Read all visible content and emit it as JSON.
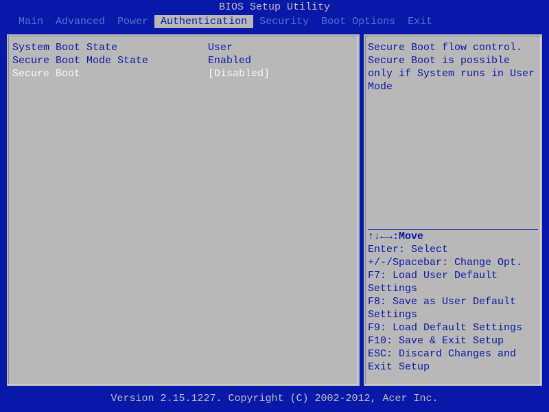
{
  "title": "BIOS Setup Utility",
  "menu": {
    "items": [
      {
        "label": "Main",
        "active": false
      },
      {
        "label": "Advanced",
        "active": false
      },
      {
        "label": "Power",
        "active": false
      },
      {
        "label": "Authentication",
        "active": true
      },
      {
        "label": "Security",
        "active": false
      },
      {
        "label": "Boot Options",
        "active": false
      },
      {
        "label": "Exit",
        "active": false
      }
    ]
  },
  "settings": [
    {
      "label": "System Boot State",
      "value": "User",
      "selected": false,
      "interactable": false
    },
    {
      "label": "Secure Boot Mode State",
      "value": "Enabled",
      "selected": false,
      "interactable": false
    },
    {
      "label": "Secure Boot",
      "value": "[Disabled]",
      "selected": true,
      "interactable": true
    }
  ],
  "help": {
    "text": "Secure Boot flow control. Secure Boot is possible only if System runs in User Mode",
    "keys": {
      "move": "↑↓←→:Move",
      "enter": "Enter: Select",
      "change": "+/-/Spacebar: Change Opt.",
      "f7": "F7: Load User Default Settings",
      "f8": "F8: Save as User Default Settings",
      "f9": "F9: Load Default Settings",
      "f10": "F10: Save & Exit Setup",
      "esc": "ESC: Discard Changes and Exit Setup"
    }
  },
  "footer": "Version 2.15.1227. Copyright (C) 2002-2012, Acer Inc."
}
